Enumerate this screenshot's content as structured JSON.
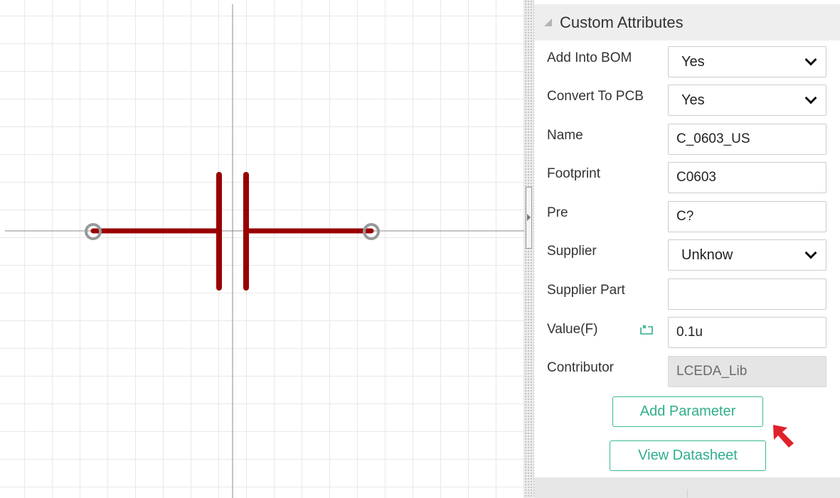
{
  "colors": {
    "wire": "#990000",
    "pin": "#999999",
    "axis": "#888888",
    "grid": "#e8e8e8",
    "accent": "#2fae8c",
    "cursor_red": "#e0202a"
  },
  "panel": {
    "title": "Custom Attributes",
    "rows": [
      {
        "label": "Add Into BOM",
        "type": "select",
        "value": "Yes",
        "icon": "chevron-down-icon"
      },
      {
        "label": "Convert To PCB",
        "type": "select",
        "value": "Yes",
        "icon": "chevron-down-icon"
      },
      {
        "label": "Name",
        "type": "text",
        "value": "C_0603_US"
      },
      {
        "label": "Footprint",
        "type": "text",
        "value": "C0603"
      },
      {
        "label": "Pre",
        "type": "text",
        "value": "C?"
      },
      {
        "label": "Supplier",
        "type": "select",
        "value": "Unknow",
        "icon": "chevron-down-icon"
      },
      {
        "label": "Supplier Part",
        "type": "text",
        "value": ""
      },
      {
        "label": "Value(F)",
        "type": "text",
        "value": "0.1u",
        "extra_icon": "expression-edit-icon"
      },
      {
        "label": "Contributor",
        "type": "text",
        "value": "LCEDA_Lib",
        "disabled": true
      }
    ],
    "buttons": {
      "add_parameter": "Add Parameter",
      "view_datasheet": "View Datasheet"
    }
  },
  "canvas": {
    "component": "capacitor-symbol",
    "cursor_icon": "mouse-pointer-icon"
  }
}
